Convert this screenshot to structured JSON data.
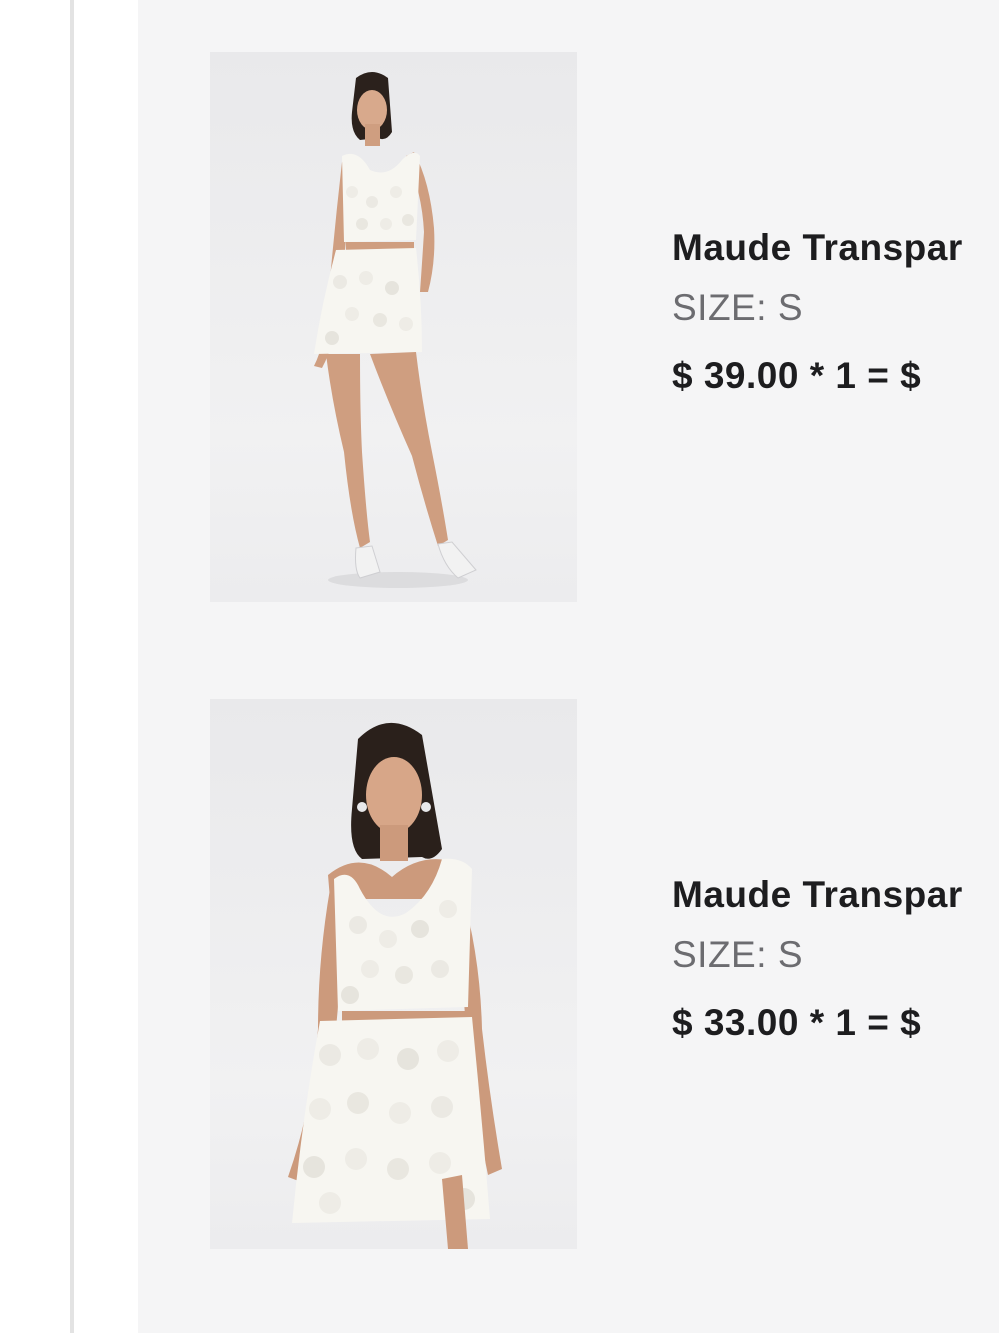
{
  "cart": {
    "items": [
      {
        "title": "Maude Transpar",
        "size_label": "SIZE:",
        "size_value": "S",
        "price_line": "$ 39.00 * 1 = $",
        "image_icon": "product-photo-model-white-sequin-set-full-length"
      },
      {
        "title": "Maude Transpar",
        "size_label": "SIZE:",
        "size_value": "S",
        "price_line": "$ 33.00 * 1 = $",
        "image_icon": "product-photo-model-white-sequin-set-three-quarter"
      }
    ]
  },
  "colors": {
    "panel_background": "#f5f5f6",
    "rail": "#e3e3e3",
    "title_text": "#1d1d1f",
    "size_text": "#6c6c70"
  }
}
